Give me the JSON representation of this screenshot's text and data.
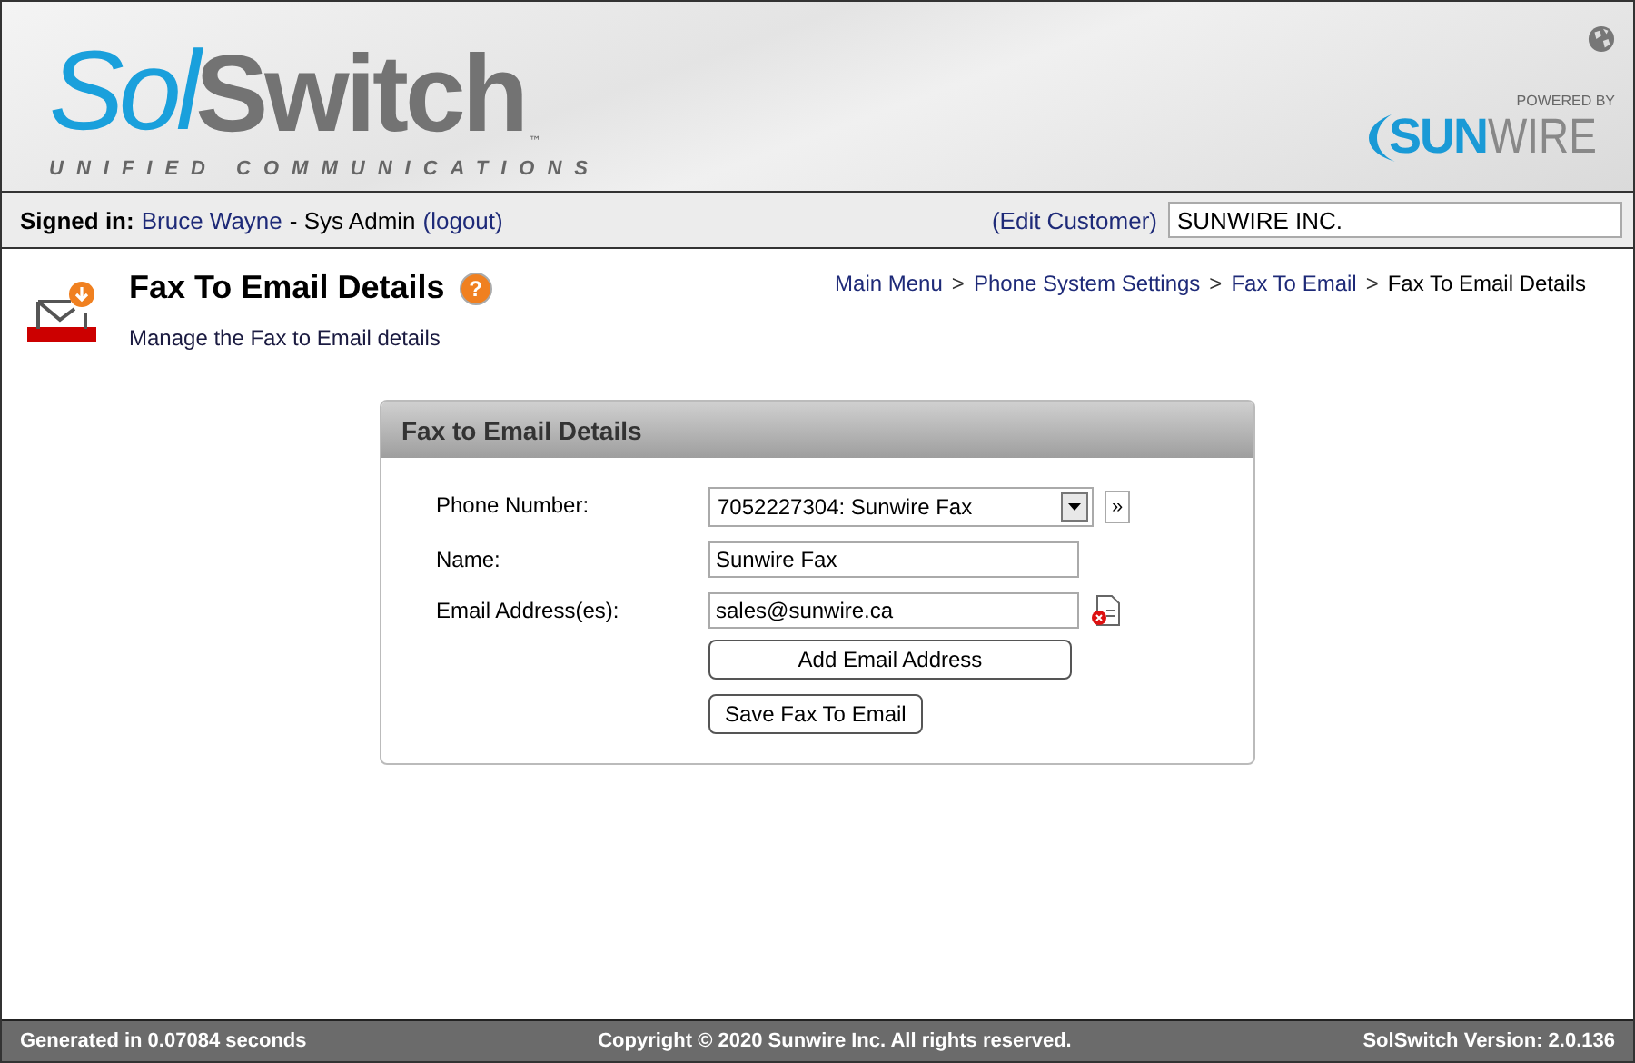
{
  "header": {
    "logo": {
      "part_1": "Sol",
      "part_2": "Switch",
      "trademark": "™",
      "tagline": "UNIFIED COMMUNICATIONS"
    },
    "partner_logo": {
      "caption": "POWERED BY",
      "part_1": "SUN",
      "part_2": "WIRE"
    }
  },
  "user_bar": {
    "label": "Signed in:",
    "user": "Bruce Wayne",
    "role": "- Sys Admin",
    "logout": "(logout)",
    "edit_customer": "(Edit Customer)",
    "customer": "SUNWIRE INC."
  },
  "page": {
    "title": "Fax To Email Details",
    "help": "?",
    "subtitle": "Manage the Fax to Email details"
  },
  "breadcrumb": {
    "separator": ">",
    "items": [
      "Main Menu",
      "Phone System Settings",
      "Fax To Email",
      "Fax To Email Details"
    ]
  },
  "panel": {
    "title": "Fax to Email Details",
    "fields": [
      {
        "kind": "select",
        "label": "Phone Number:",
        "value": "7052227304: Sunwire Fax",
        "extra": "»"
      },
      {
        "kind": "text",
        "label": "Name:",
        "value": "Sunwire Fax"
      },
      {
        "kind": "email",
        "label": "Email Address(es):",
        "value": "sales@sunwire.ca"
      }
    ],
    "add_button": "Add Email Address",
    "save_button": "Save Fax To Email"
  },
  "footer": {
    "generated": "Generated in 0.07084 seconds",
    "copyright": "Copyright © 2020 Sunwire Inc. All rights reserved.",
    "version": "SolSwitch Version: 2.0.136"
  }
}
